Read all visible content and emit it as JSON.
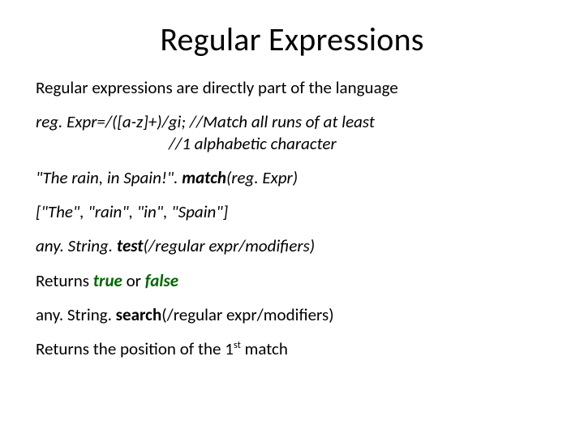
{
  "title": "Regular Expressions",
  "line1": "Regular expressions are directly part of the language",
  "code1a": "reg. Expr=/([a-z]+)/gi;  //Match all runs of at least",
  "code1b": "//1 alphabetic character",
  "match_pre": "\"The rain, in Spain!\". ",
  "match_bold": "match",
  "match_post": "(reg. Expr)",
  "result_arr": "[\"The\", \"rain\", \"in\", \"Spain\"]",
  "test_pre": "any. String. ",
  "test_bold": "test",
  "test_post": "(/regular expr/modifiers)",
  "returns_label": "Returns ",
  "true_word": "true",
  "or_word": "  or ",
  "false_word": "false",
  "search_pre": "any. String. ",
  "search_bold": "search",
  "search_post": "(/regular expr/modifiers)",
  "returns_pos_a": "Returns the position of the 1",
  "returns_pos_sup": "st",
  "returns_pos_b": " match"
}
